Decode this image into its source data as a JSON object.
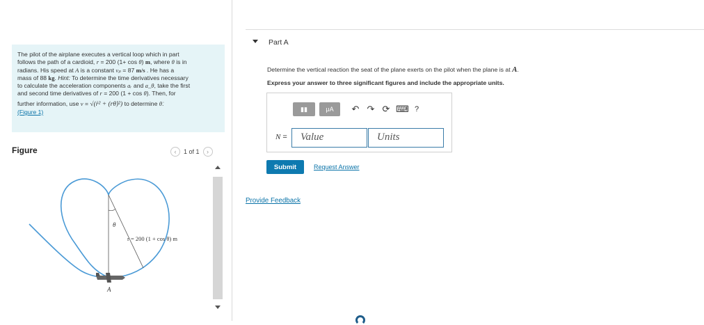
{
  "problem": {
    "l1": "The pilot of the airplane executes a vertical loop which in part",
    "l2a": "follows the path of a cardioid, ",
    "l2r": "r",
    "l2b": " = 200 (1+ cos ",
    "l2theta": "θ",
    "l2c": ") ",
    "l2m": "m",
    "l2d": ", where ",
    "l2theta2": "θ",
    "l2e": " is in",
    "l3a": "radians. His speed at ",
    "l3A": "A",
    "l3b": " is a constant ",
    "l3vp": "vₚ",
    "l3c": " = 87 ",
    "l3u": "m/s",
    "l3d": " . He has a",
    "l4a": "mass of 88 ",
    "l4kg": "kg",
    "l4b": ". ",
    "l4hint": "Hint:",
    "l4c": " To determine the time derivatives necessary",
    "l5a": "to calculate the acceleration components ",
    "l5ar": "aᵣ",
    "l5b": " and ",
    "l5at": "a_θ",
    "l5c": ", take the first",
    "l6a": "and second time derivatives of ",
    "l6r": "r",
    "l6b": " = 200 (1 + cos ",
    "l6t": "θ",
    "l6c": "). Then, for",
    "l7a": "further information, use ",
    "l7v": "v",
    "l7b": " = ",
    "l7formula": "√(ṙ² + (rθ̇)²)",
    "l7c": " to determine ",
    "l7td": "θ̇",
    "l7d": ".",
    "figure_link": "(Figure 1)"
  },
  "figure_panel": {
    "title": "Figure",
    "pager": "1 of 1",
    "prev_icon": "‹",
    "next_icon": "›",
    "label_theta": "θ",
    "label_r": "r = 200 (1 + cos θ) m",
    "label_A": "A"
  },
  "part": {
    "title": "Part A",
    "question_a": "Determine the vertical reaction the seat of the plane exerts on the pilot when the plane is at ",
    "question_A": "A",
    "question_b": ".",
    "instructions": "Express your answer to three significant figures and include the appropriate units."
  },
  "answer": {
    "toolbar": {
      "templates_icon": "▮▮",
      "units_button": "μA",
      "undo_icon": "↶",
      "redo_icon": "↷",
      "reset_icon": "⟳",
      "keyboard_icon": "⌨",
      "help_icon": "?"
    },
    "var_label": "N",
    "var_eq": " =",
    "value_placeholder": "Value",
    "units_placeholder": "Units"
  },
  "actions": {
    "submit": "Submit",
    "request_answer": "Request Answer",
    "provide_feedback": "Provide Feedback"
  }
}
